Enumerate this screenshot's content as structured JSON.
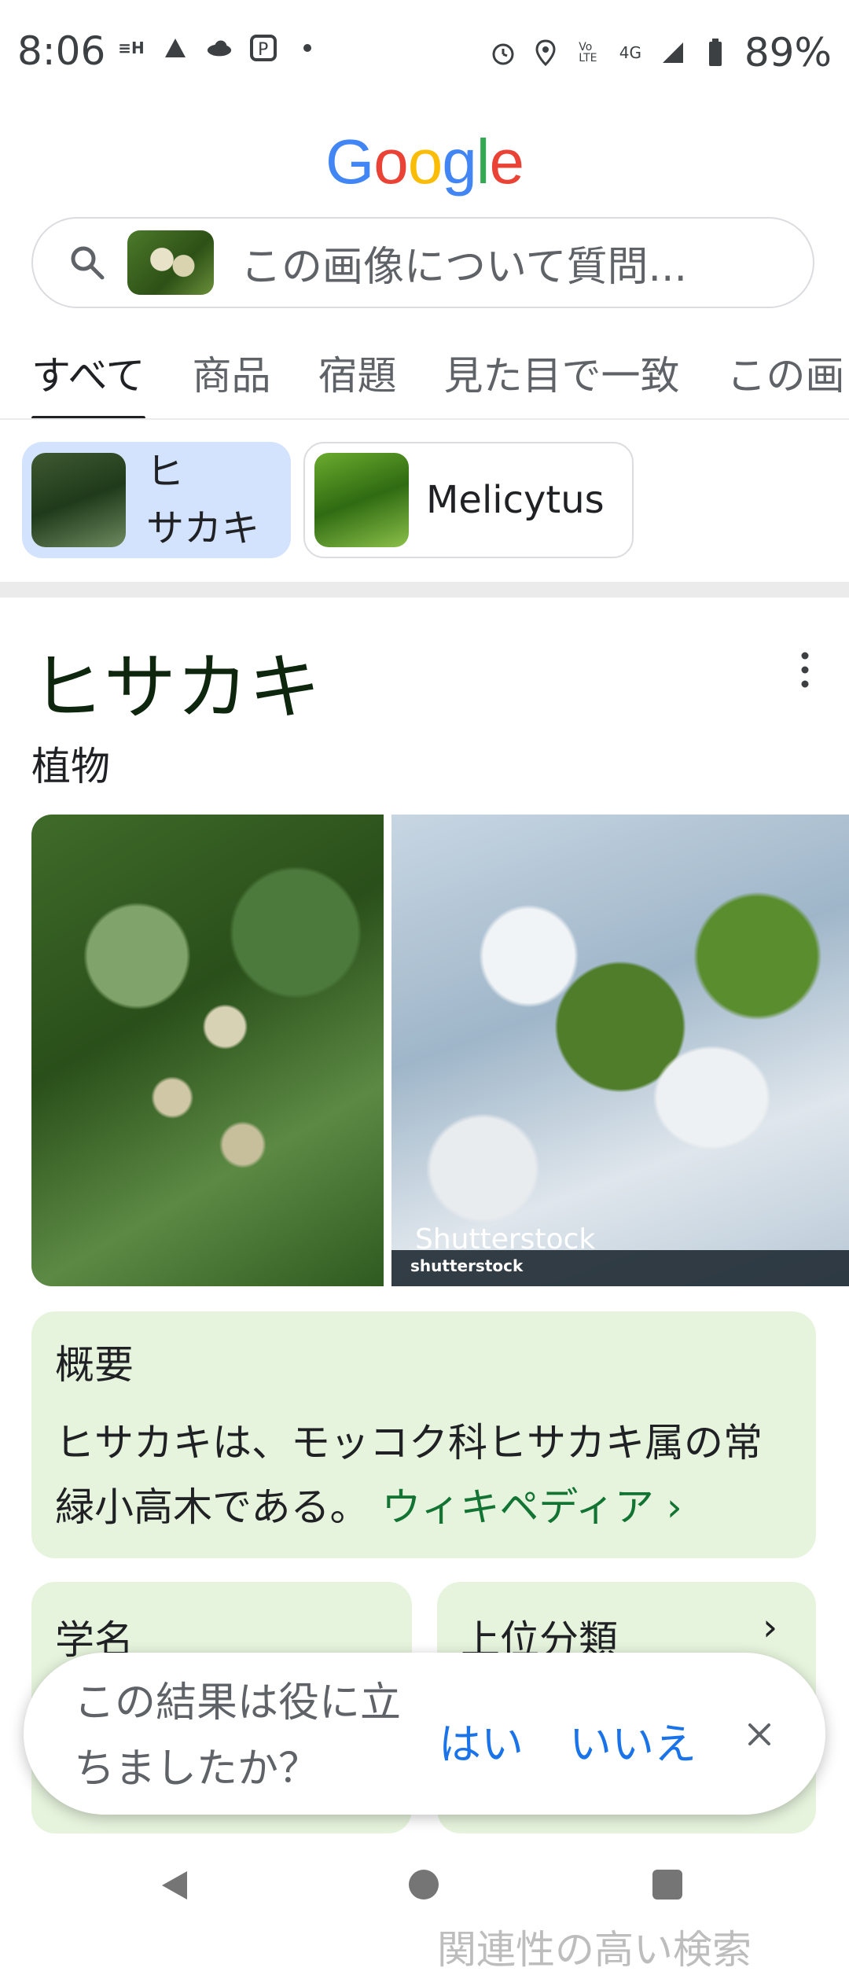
{
  "status_bar": {
    "time": "8:06",
    "left_icons": [
      "hyper-icon",
      "drive-icon",
      "cloud-icon",
      "paypay-icon",
      "dot-icon"
    ],
    "right_icons": [
      "alarm-icon",
      "location-icon",
      "volte-icon",
      "4g-icon",
      "signal-icon",
      "battery-icon"
    ],
    "battery": "89%"
  },
  "logo": {
    "letters": [
      "G",
      "o",
      "o",
      "g",
      "l",
      "e"
    ],
    "colors": [
      "#4285F4",
      "#EA4335",
      "#FBBC05",
      "#4285F4",
      "#34A853",
      "#EA4335"
    ]
  },
  "search": {
    "placeholder": "この画像について質問..."
  },
  "tabs": [
    "すべて",
    "商品",
    "宿題",
    "見た目で一致",
    "この画"
  ],
  "chips": [
    {
      "label_line1": "ヒ",
      "label_line2": "サカキ",
      "selected": true
    },
    {
      "label": "Melicytus",
      "selected": false
    }
  ],
  "entity": {
    "title": "ヒサカキ",
    "subtitle": "植物",
    "image_caption": "Shutterstock",
    "image_watermark": "shutterstock"
  },
  "overview": {
    "title": "概要",
    "text": "ヒサカキは、モッコク科ヒサカキ属の常緑小高木である。",
    "link": "ウィキペディア ›"
  },
  "cards": [
    {
      "title": "学名"
    },
    {
      "title": "上位分類",
      "arrow": "›"
    }
  ],
  "feedback": {
    "question": "この結果は役に立ちましたか？",
    "yes": "はい",
    "no": "いいえ"
  },
  "peek_text": "関連性の高い検索"
}
